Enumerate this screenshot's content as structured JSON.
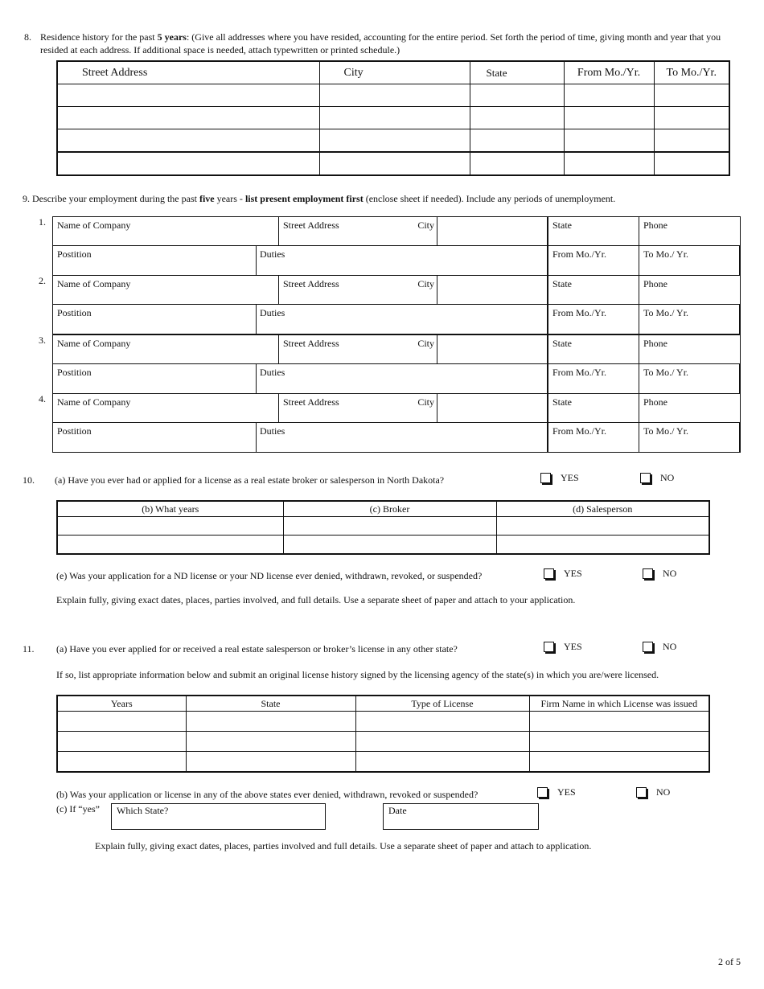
{
  "q8": {
    "number": "8.",
    "text_pre": "Residence history for the past ",
    "text_bold": "5 years",
    "text_post": ": (Give all addresses where you have resided, accounting for the entire period. Set forth the period of time,  giving month and year that you",
    "line2": "resided at each address. If additional space is needed, attach typewritten or printed schedule.)",
    "columns": [
      "Street Address",
      "City",
      "State",
      "From Mo./Yr.",
      "To Mo./Yr."
    ],
    "rows": [
      [
        "",
        "",
        "",
        "",
        ""
      ],
      [
        "",
        "",
        "",
        "",
        ""
      ],
      [
        "",
        "",
        "",
        "",
        ""
      ],
      [
        "",
        "",
        "",
        "",
        ""
      ]
    ]
  },
  "q9": {
    "text_pre": "9. Describe your employment during the past ",
    "text_bold1": "five",
    "text_mid": " years - ",
    "text_bold2": "list present employment first",
    "text_post": " (enclose sheet if needed).  Include any periods of unemployment.",
    "entries": [
      {
        "number": "1.",
        "company": "Name of Company",
        "street": "Street Address",
        "city": "City",
        "state": "State",
        "phone": "Phone",
        "position": "Postition",
        "duties": "Duties",
        "from": "From Mo./Yr.",
        "to": "To Mo./ Yr."
      },
      {
        "number": "2.",
        "company": "Name of Company",
        "street": "Street Address",
        "city": "City",
        "state": "State",
        "phone": "Phone",
        "position": "Postition",
        "duties": "Duties",
        "from": "From Mo./Yr.",
        "to": "To Mo./ Yr."
      },
      {
        "number": "3.",
        "company": "Name of Company",
        "street": "Street Address",
        "city": "City",
        "state": "State",
        "phone": "Phone",
        "position": "Postition",
        "duties": "Duties",
        "from": "From Mo./Yr.",
        "to": "To Mo./ Yr."
      },
      {
        "number": "4.",
        "company": "Name of Company",
        "street": "Street Address",
        "city": "City",
        "state": "State",
        "phone": "Phone",
        "position": "Postition",
        "duties": "Duties",
        "from": "From Mo./Yr.",
        "to": "To Mo./ Yr."
      }
    ]
  },
  "q10": {
    "number": "10.",
    "a_text": "(a) Have you ever had or applied for a license as a real estate broker or salesperson in North Dakota?",
    "yes": "YES",
    "no": "NO",
    "columns": [
      "(b) What years",
      "(c) Broker",
      "(d) Salesperson"
    ],
    "rows": [
      [
        "",
        "",
        ""
      ],
      [
        "",
        "",
        ""
      ]
    ],
    "e_text": "(e) Was your application for a ND license or your ND license ever denied, withdrawn, revoked, or suspended?",
    "explain": "Explain fully, giving exact dates, places, parties involved, and full details. Use a separate sheet of paper and attach to your application."
  },
  "q11": {
    "number": "11.",
    "a_text": "(a)  Have you ever applied for or received a real estate salesperson or broker’s license in any other state?",
    "yes": "YES",
    "no": "NO",
    "if_so": "If so, list appropriate information below and submit an original license history signed by the licensing agency of the state(s) in which you are/were licensed.",
    "columns": [
      "Years",
      "State",
      "Type of License",
      "Firm Name in which License was issued"
    ],
    "rows": [
      [
        "",
        "",
        "",
        ""
      ],
      [
        "",
        "",
        "",
        ""
      ],
      [
        "",
        "",
        "",
        ""
      ]
    ],
    "b_text": "(b)  Was your application or license in any of the above states ever denied, withdrawn, revoked or suspended?",
    "c_label": "(c)   If “yes”",
    "which_state": "Which State?",
    "date": "Date",
    "explain": "Explain fully, giving exact dates, places, parties involved and full details. Use a separate sheet of paper and attach to application."
  },
  "footer": {
    "page": "2 of 5"
  }
}
